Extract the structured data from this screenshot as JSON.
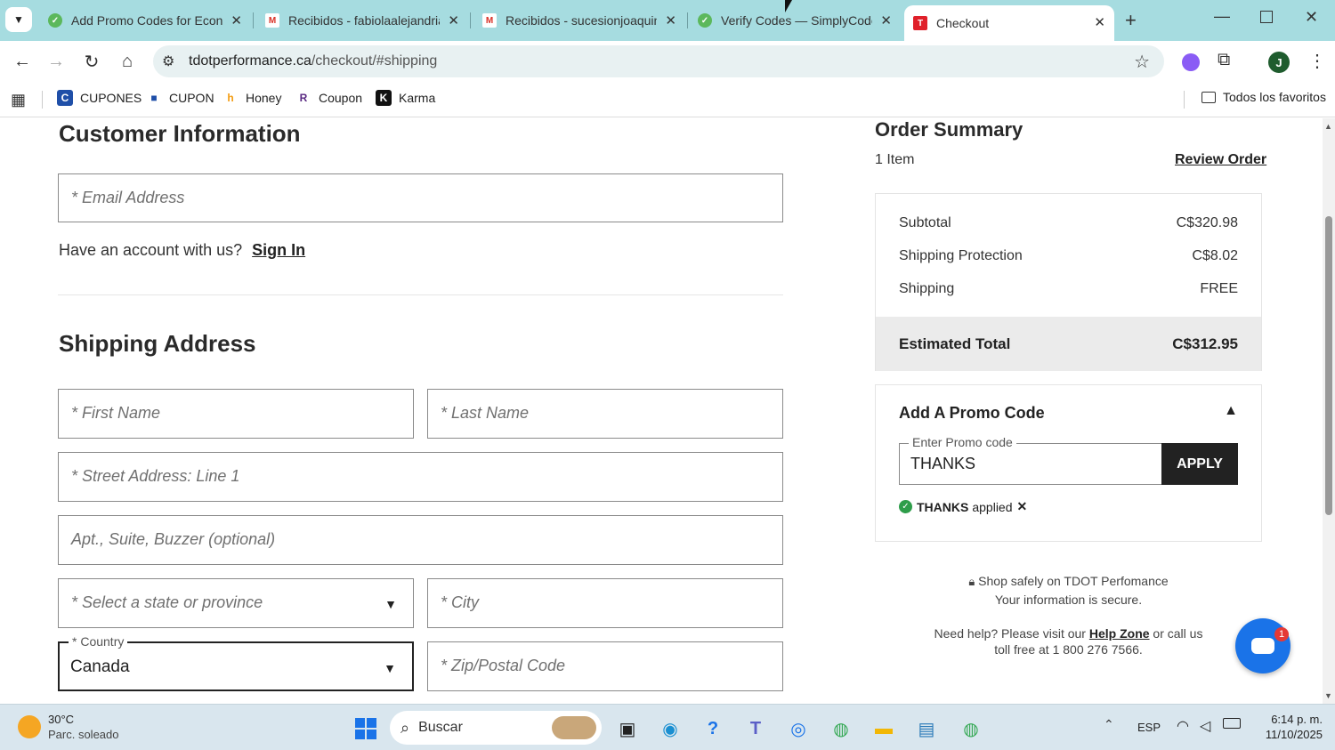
{
  "browser": {
    "tabs": [
      {
        "title": "Add Promo Codes for Econo",
        "icon": "simplycodes-icon"
      },
      {
        "title": "Recibidos - fabiolaalejandria",
        "icon": "gmail-icon"
      },
      {
        "title": "Recibidos - sucesionjoaquin",
        "icon": "gmail-icon"
      },
      {
        "title": "Verify Codes — SimplyCodes",
        "icon": "simplycodes-icon"
      },
      {
        "title": "Checkout",
        "icon": "tdot-icon"
      }
    ],
    "url_domain": "tdotperformance.ca",
    "url_path": "/checkout/#shipping",
    "bookmarks": [
      {
        "label": "CUPONES",
        "icon": "bookmark-c-icon"
      },
      {
        "label": "CUPON",
        "icon": "bookmark-bag-icon"
      },
      {
        "label": "Honey",
        "icon": "honey-icon"
      },
      {
        "label": "Coupon",
        "icon": "coupon-icon"
      },
      {
        "label": "Karma",
        "icon": "karma-icon"
      }
    ],
    "all_bookmarks": "Todos los favoritos",
    "profile_initial": "J"
  },
  "customer": {
    "title": "Customer Information",
    "email_placeholder": "* Email Address",
    "have_account": "Have an account with us?",
    "sign_in": "Sign In"
  },
  "shipping": {
    "title": "Shipping Address",
    "first_name": "* First Name",
    "last_name": "* Last Name",
    "street": "* Street Address: Line 1",
    "apt": "Apt., Suite, Buzzer (optional)",
    "state": "* Select a state or province",
    "city": "* City",
    "country_label": "* Country",
    "country_value": "Canada",
    "zip": "* Zip/Postal Code"
  },
  "summary": {
    "title": "Order Summary",
    "items": "1 Item",
    "review": "Review Order",
    "subtotal_label": "Subtotal",
    "subtotal": "C$320.98",
    "protection_label": "Shipping Protection",
    "protection": "C$8.02",
    "shipping_label": "Shipping",
    "shipping": "FREE",
    "total_label": "Estimated Total",
    "total": "C$312.95",
    "promo_title": "Add A Promo Code",
    "promo_field_label": "Enter Promo code",
    "promo_value": "THANKS",
    "apply": "APPLY",
    "applied_code": "THANKS",
    "applied_text": "applied",
    "secure_line1": "Shop safely on TDOT Perfomance",
    "secure_line2": "Your information is secure.",
    "help_prefix": "Need help? Please visit our",
    "help_link": "Help Zone",
    "help_suffix": "or call us",
    "help_line2": "toll free at 1 800 276 7566.",
    "chat_badge": "1"
  },
  "taskbar": {
    "temp": "30°C",
    "weather": "Parc. soleado",
    "search": "Buscar",
    "lang": "ESP",
    "time": "6:14 p. m.",
    "date": "11/10/2025"
  },
  "colors": {
    "tabstrip": "#a6dce0",
    "accent": "#222222",
    "success": "#2e9d4a",
    "chat": "#1a73e8"
  }
}
